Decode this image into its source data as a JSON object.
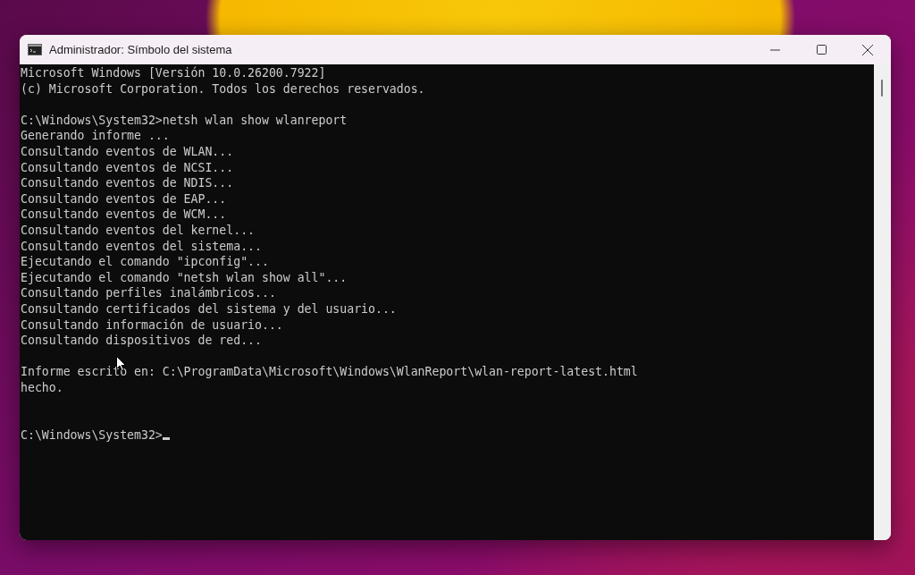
{
  "window": {
    "title": "Administrador: Símbolo del sistema"
  },
  "console": {
    "blocks": [
      [
        "Microsoft Windows [Versión 10.0.26200.7922]",
        "(c) Microsoft Corporation. Todos los derechos reservados."
      ],
      [
        "C:\\Windows\\System32>netsh wlan show wlanreport",
        "Generando informe ...",
        "Consultando eventos de WLAN...",
        "Consultando eventos de NCSI...",
        "Consultando eventos de NDIS...",
        "Consultando eventos de EAP...",
        "Consultando eventos de WCM...",
        "Consultando eventos del kernel...",
        "Consultando eventos del sistema...",
        "Ejecutando el comando \"ipconfig\"...",
        "Ejecutando el comando \"netsh wlan show all\"...",
        "Consultando perfiles inalámbricos...",
        "Consultando certificados del sistema y del usuario...",
        "Consultando información de usuario...",
        "Consultando dispositivos de red..."
      ],
      [
        "Informe escrito en: C:\\ProgramData\\Microsoft\\Windows\\WlanReport\\wlan-report-latest.html",
        "hecho."
      ]
    ],
    "prompt": {
      "text": "C:\\Windows\\System32>",
      "cursor": true
    }
  }
}
